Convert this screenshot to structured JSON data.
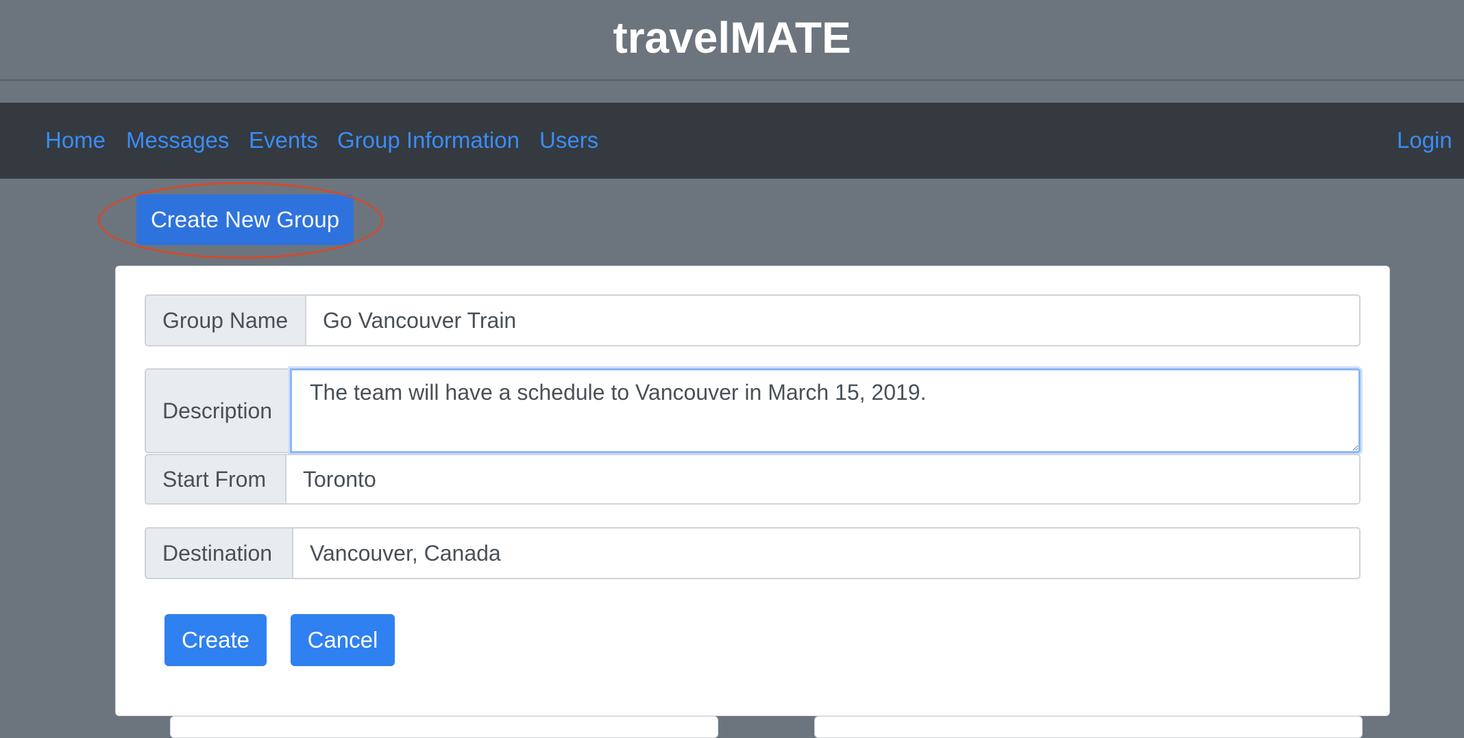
{
  "header": {
    "brand": "travelMATE"
  },
  "nav": {
    "items": [
      {
        "label": "Home"
      },
      {
        "label": "Messages"
      },
      {
        "label": "Events"
      },
      {
        "label": "Group Information"
      },
      {
        "label": "Users"
      }
    ],
    "login": "Login"
  },
  "toolbar": {
    "create_group_label": "Create New Group"
  },
  "form": {
    "group_name": {
      "label": "Group Name",
      "value": "Go Vancouver Train"
    },
    "description": {
      "label": "Description",
      "value": "The team will have a schedule to Vancouver in March 15, 2019."
    },
    "start_from": {
      "label": "Start From",
      "value": "Toronto"
    },
    "destination": {
      "label": "Destination",
      "value": "Vancouver, Canada"
    },
    "create_label": "Create",
    "cancel_label": "Cancel"
  },
  "colors": {
    "page_background": "#6c757d",
    "navbar_background": "#343a40",
    "link": "#3b8cf7",
    "primary_button": "#2f80f0",
    "annotation": "#d24a2c"
  }
}
